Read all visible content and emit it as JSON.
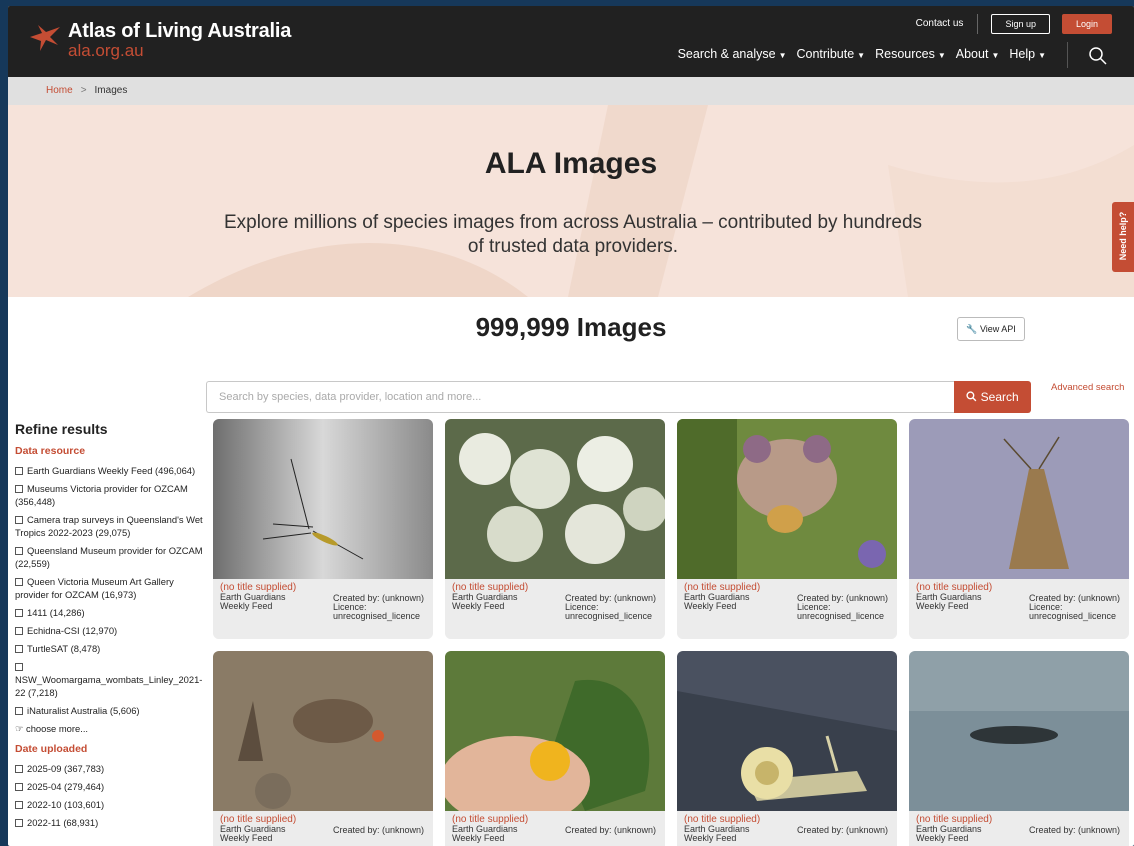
{
  "header": {
    "logo_title": "Atlas of Living Australia",
    "logo_url": "ala.org.au",
    "contact": "Contact us",
    "signup": "Sign up",
    "login": "Login",
    "nav": [
      {
        "label": "Search & analyse"
      },
      {
        "label": "Contribute"
      },
      {
        "label": "Resources"
      },
      {
        "label": "About"
      },
      {
        "label": "Help"
      }
    ]
  },
  "breadcrumb": {
    "home": "Home",
    "current": "Images"
  },
  "hero": {
    "title": "ALA Images",
    "subtitle": "Explore millions of species images from across Australia – contributed by hundreds of trusted data providers."
  },
  "need_help": "Need help?",
  "count_label": "999,999 Images",
  "view_api": "View API",
  "search": {
    "placeholder": "Search by species, data provider, location and more...",
    "button": "Search",
    "advanced": "Advanced search"
  },
  "sidebar": {
    "title": "Refine results",
    "data_resource_heading": "Data resource",
    "data_resources": [
      "Earth Guardians Weekly Feed (496,064)",
      "Museums Victoria provider for OZCAM (356,448)",
      "Camera trap surveys in Queensland's Wet Tropics 2022-2023 (29,075)",
      "Queensland Museum provider for OZCAM (22,559)",
      "Queen Victoria Museum Art Gallery provider for OZCAM (16,973)",
      "1411 (14,286)",
      "Echidna-CSI (12,970)",
      "TurtleSAT (8,478)",
      "NSW_Woomargama_wombats_Linley_2021-22 (7,218)",
      "iNaturalist Australia (5,606)"
    ],
    "choose_more": "choose more...",
    "date_heading": "Date uploaded",
    "dates": [
      "2025-09 (367,783)",
      "2025-04 (279,464)",
      "2022-10 (103,601)",
      "2022-11 (68,931)"
    ]
  },
  "cards": [
    {
      "title": "(no title supplied)",
      "source": "Earth Guardians Weekly Feed",
      "created": "Created by: (unknown)",
      "licence": "Licence: unrecognised_licence"
    },
    {
      "title": "(no title supplied)",
      "source": "Earth Guardians Weekly Feed",
      "created": "Created by: (unknown)",
      "licence": "Licence: unrecognised_licence"
    },
    {
      "title": "(no title supplied)",
      "source": "Earth Guardians Weekly Feed",
      "created": "Created by: (unknown)",
      "licence": "Licence: unrecognised_licence"
    },
    {
      "title": "(no title supplied)",
      "source": "Earth Guardians Weekly Feed",
      "created": "Created by: (unknown)",
      "licence": "Licence: unrecognised_licence"
    },
    {
      "title": "(no title supplied)",
      "source": "Earth Guardians Weekly Feed",
      "created": "Created by: (unknown)"
    },
    {
      "title": "(no title supplied)",
      "source": "Earth Guardians Weekly Feed",
      "created": "Created by: (unknown)"
    },
    {
      "title": "(no title supplied)",
      "source": "Earth Guardians Weekly Feed",
      "created": "Created by: (unknown)"
    },
    {
      "title": "(no title supplied)",
      "source": "Earth Guardians Weekly Feed",
      "created": "Created by: (unknown)"
    }
  ],
  "colors": {
    "brand": "#c44d34",
    "header_bg": "#212121",
    "hero_bg": "#f6e3da"
  },
  "icons": [
    "ala-logo-icon",
    "search-icon",
    "wrench-icon",
    "hand-pointer-icon",
    "checkbox-icon"
  ]
}
